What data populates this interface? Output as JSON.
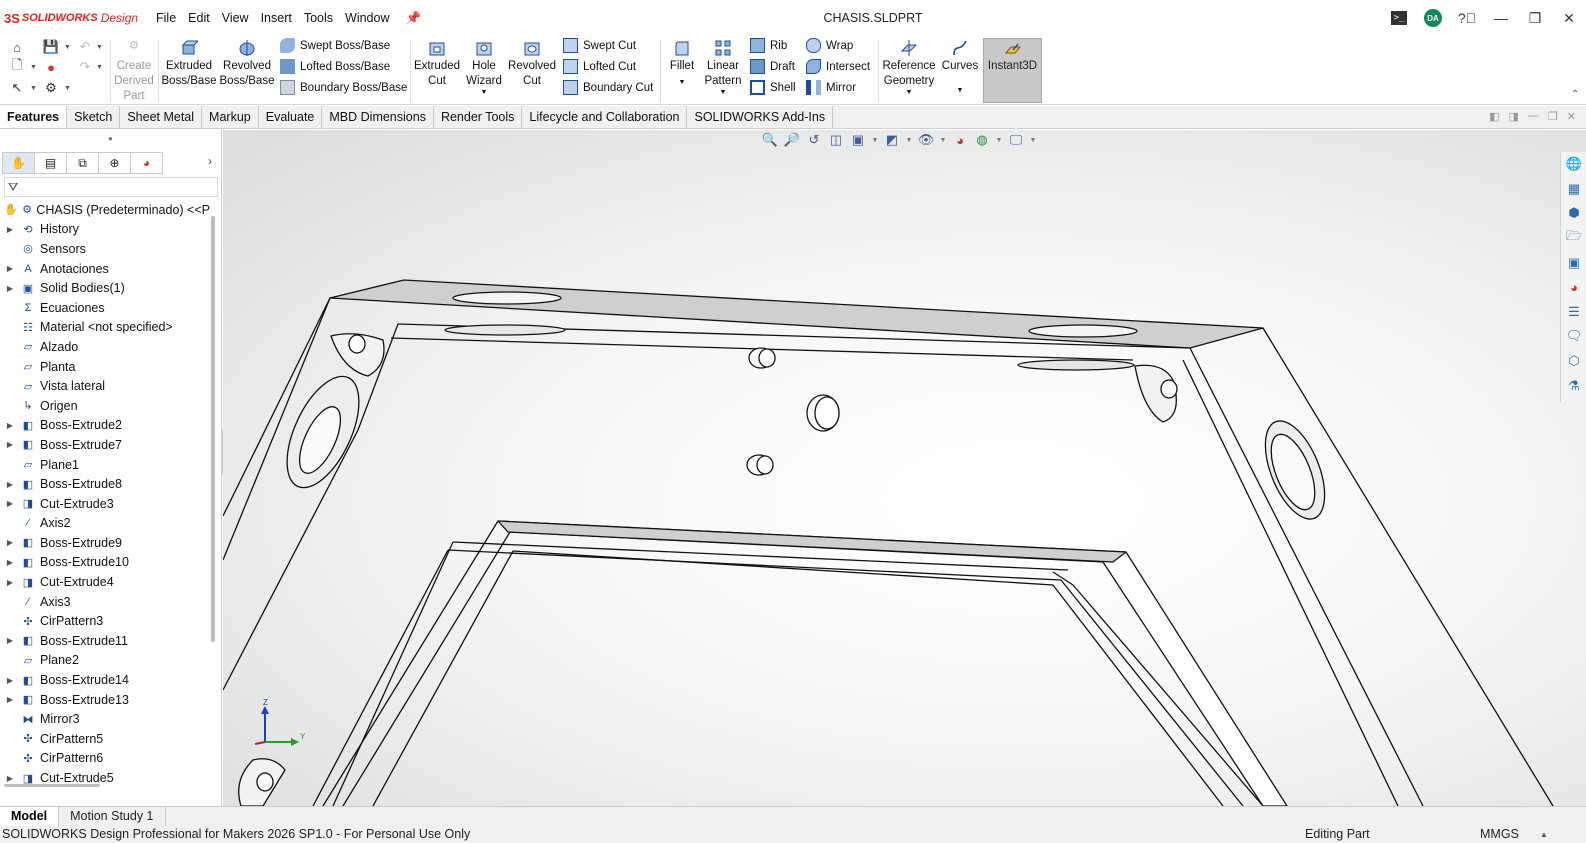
{
  "app": {
    "logo_ds": "3S",
    "logo_brand": "SOLIDWORKS",
    "logo_suffix": "Design",
    "document_title": "CHASIS.SLDPRT",
    "user_initials": "DA"
  },
  "menu": [
    "File",
    "Edit",
    "View",
    "Insert",
    "Tools",
    "Window"
  ],
  "ribbon": {
    "create_derived_part": [
      "Create",
      "Derived",
      "Part"
    ],
    "extruded_boss": [
      "Extruded",
      "Boss/Base"
    ],
    "revolved_boss": [
      "Revolved",
      "Boss/Base"
    ],
    "swept_boss": "Swept Boss/Base",
    "lofted_boss": "Lofted Boss/Base",
    "boundary_boss": "Boundary Boss/Base",
    "extruded_cut": [
      "Extruded",
      "Cut"
    ],
    "hole_wizard": [
      "Hole",
      "Wizard"
    ],
    "revolved_cut": [
      "Revolved",
      "Cut"
    ],
    "swept_cut": "Swept Cut",
    "lofted_cut": "Lofted Cut",
    "boundary_cut": "Boundary Cut",
    "fillet": "Fillet",
    "linear_pattern": [
      "Linear",
      "Pattern"
    ],
    "rib": "Rib",
    "draft": "Draft",
    "shell": "Shell",
    "wrap": "Wrap",
    "intersect": "Intersect",
    "mirror": "Mirror",
    "reference_geometry": [
      "Reference",
      "Geometry"
    ],
    "curves": "Curves",
    "instant3d": "Instant3D"
  },
  "command_tabs": [
    "Features",
    "Sketch",
    "Sheet Metal",
    "Markup",
    "Evaluate",
    "MBD Dimensions",
    "Render Tools",
    "Lifecycle and Collaboration",
    "SOLIDWORKS Add-Ins"
  ],
  "tree": {
    "root": "CHASIS (Predeterminado) <<P",
    "items": [
      {
        "label": "History",
        "icon": "history-icon",
        "expand": true
      },
      {
        "label": "Sensors",
        "icon": "sensors-icon",
        "expand": false
      },
      {
        "label": "Anotaciones",
        "icon": "annotations-icon",
        "expand": true
      },
      {
        "label": "Solid Bodies(1)",
        "icon": "solid-bodies-icon",
        "expand": true
      },
      {
        "label": "Ecuaciones",
        "icon": "equations-icon",
        "expand": false
      },
      {
        "label": "Material <not specified>",
        "icon": "material-icon",
        "expand": false
      },
      {
        "label": "Alzado",
        "icon": "plane-icon",
        "expand": false
      },
      {
        "label": "Planta",
        "icon": "plane-icon",
        "expand": false
      },
      {
        "label": "Vista lateral",
        "icon": "plane-icon",
        "expand": false
      },
      {
        "label": "Origen",
        "icon": "origin-icon",
        "expand": false
      },
      {
        "label": "Boss-Extrude2",
        "icon": "boss-extrude-icon",
        "expand": true
      },
      {
        "label": "Boss-Extrude7",
        "icon": "boss-extrude-icon",
        "expand": true
      },
      {
        "label": "Plane1",
        "icon": "plane-icon",
        "expand": false
      },
      {
        "label": "Boss-Extrude8",
        "icon": "boss-extrude-icon",
        "expand": true
      },
      {
        "label": "Cut-Extrude3",
        "icon": "cut-extrude-icon",
        "expand": true
      },
      {
        "label": "Axis2",
        "icon": "axis-icon",
        "expand": false
      },
      {
        "label": "Boss-Extrude9",
        "icon": "boss-extrude-icon",
        "expand": true
      },
      {
        "label": "Boss-Extrude10",
        "icon": "boss-extrude-icon",
        "expand": true
      },
      {
        "label": "Cut-Extrude4",
        "icon": "cut-extrude-icon",
        "expand": true
      },
      {
        "label": "Axis3",
        "icon": "axis-icon",
        "expand": false
      },
      {
        "label": "CirPattern3",
        "icon": "circular-pattern-icon",
        "expand": false
      },
      {
        "label": "Boss-Extrude11",
        "icon": "boss-extrude-icon",
        "expand": true
      },
      {
        "label": "Plane2",
        "icon": "plane-icon",
        "expand": false
      },
      {
        "label": "Boss-Extrude14",
        "icon": "boss-extrude-icon",
        "expand": true
      },
      {
        "label": "Boss-Extrude13",
        "icon": "boss-extrude-icon",
        "expand": true
      },
      {
        "label": "Mirror3",
        "icon": "mirror-icon",
        "expand": false
      },
      {
        "label": "CirPattern5",
        "icon": "circular-pattern-icon",
        "expand": false
      },
      {
        "label": "CirPattern6",
        "icon": "circular-pattern-icon",
        "expand": false
      },
      {
        "label": "Cut-Extrude5",
        "icon": "cut-extrude-icon",
        "expand": true
      }
    ]
  },
  "triad": {
    "z": "Z",
    "y": "Y"
  },
  "bottom_tabs": [
    "Model",
    "Motion Study 1"
  ],
  "status": {
    "product": "SOLIDWORKS Design Professional for Makers 2026 SP1.0 - For Personal Use Only",
    "mode": "Editing Part",
    "units": "MMGS"
  },
  "colors": {
    "brand_red": "#e1251b",
    "accent_blue": "#1f4e9a",
    "instant3d_active_bg": "#c8c8c8"
  }
}
